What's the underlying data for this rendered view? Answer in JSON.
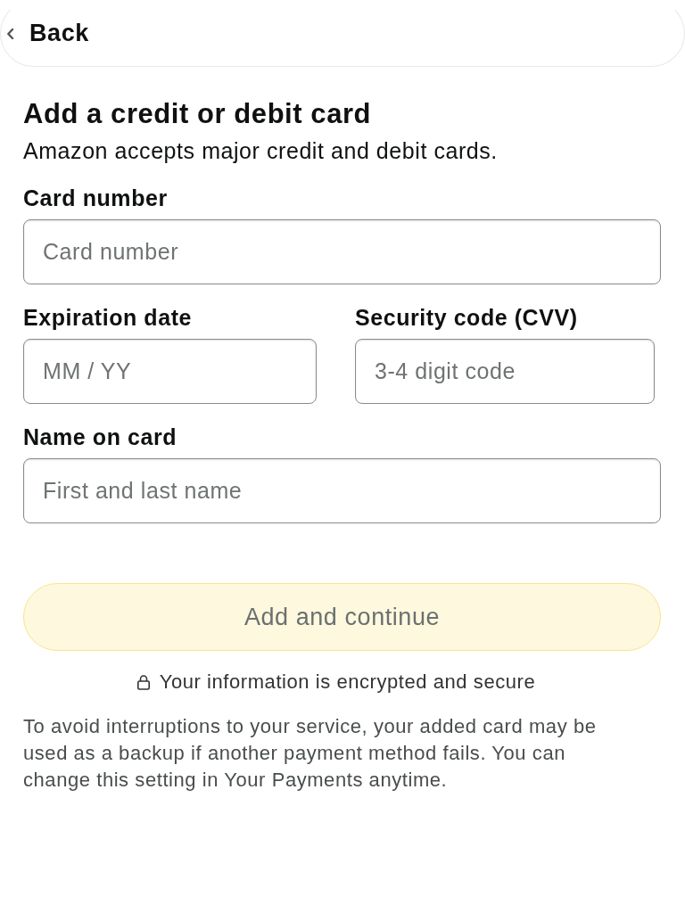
{
  "header": {
    "back_label": "Back"
  },
  "heading": "Add a credit or debit card",
  "subtitle": "Amazon accepts major credit and debit cards.",
  "field_rows": [
    [
      {
        "label": "Card number",
        "placeholder": "Card number"
      }
    ],
    [
      {
        "label": "Expiration date",
        "placeholder": "MM / YY"
      },
      {
        "label": "Security code (CVV)",
        "placeholder": "3-4 digit code"
      }
    ],
    [
      {
        "label": "Name on card",
        "placeholder": "First and last name"
      }
    ]
  ],
  "submit": {
    "label": "Add and continue",
    "disabled": true
  },
  "security_note": "Your information is encrypted and secure",
  "footnote": "To avoid interruptions to your service, your added card may be used as a backup if another payment method fails. You can change this setting in Your Payments anytime."
}
